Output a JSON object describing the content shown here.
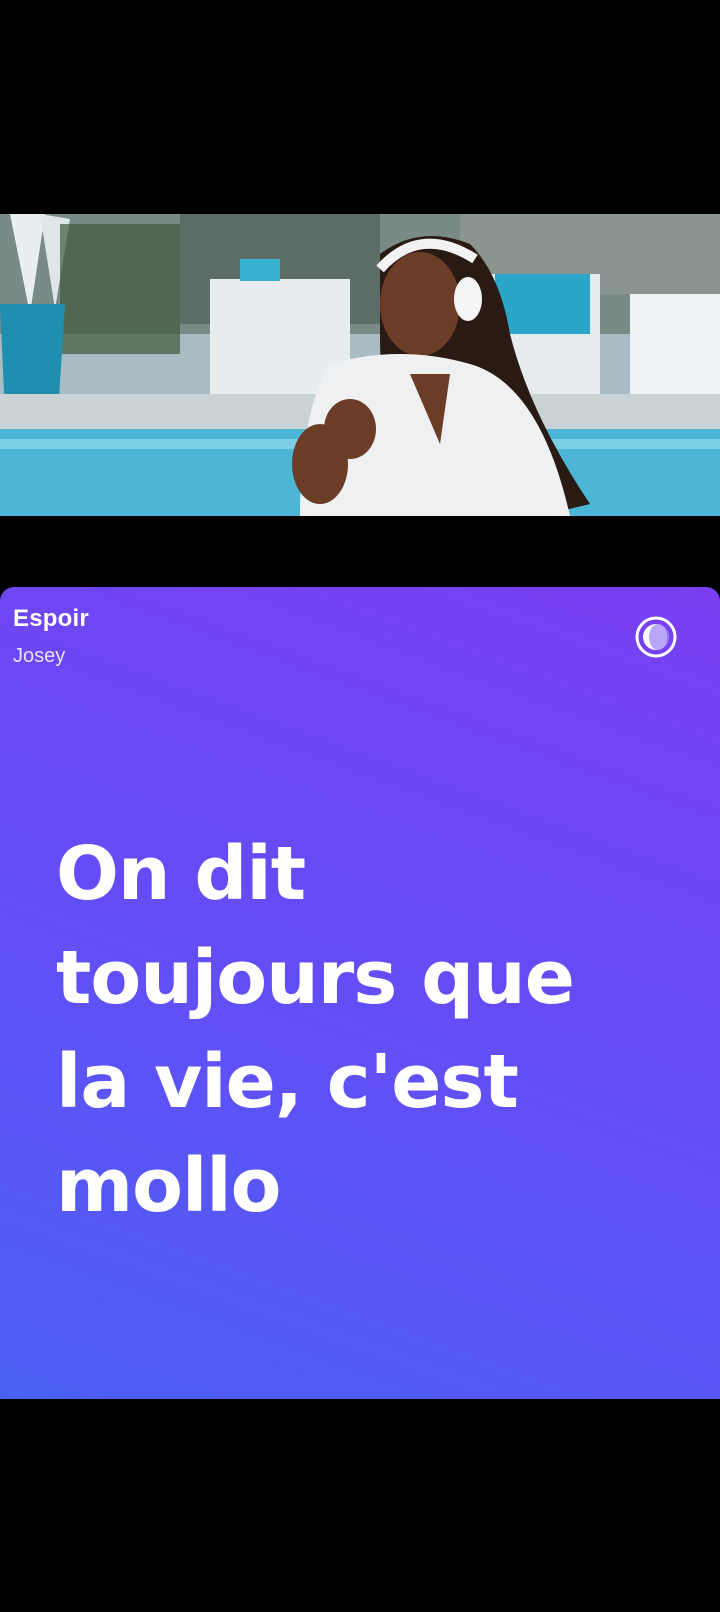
{
  "player": {
    "song_title": "Espoir",
    "artist": "Josey",
    "toggle_icon": "lyrics-theme-icon"
  },
  "lyrics": {
    "current_line": "On dit\ntoujours que\nla vie, c'est\nmollo"
  },
  "colors": {
    "card_gradient_start": "#7a3ff2",
    "card_gradient_end": "#4b60f3",
    "text": "#ffffff",
    "background": "#000000"
  }
}
